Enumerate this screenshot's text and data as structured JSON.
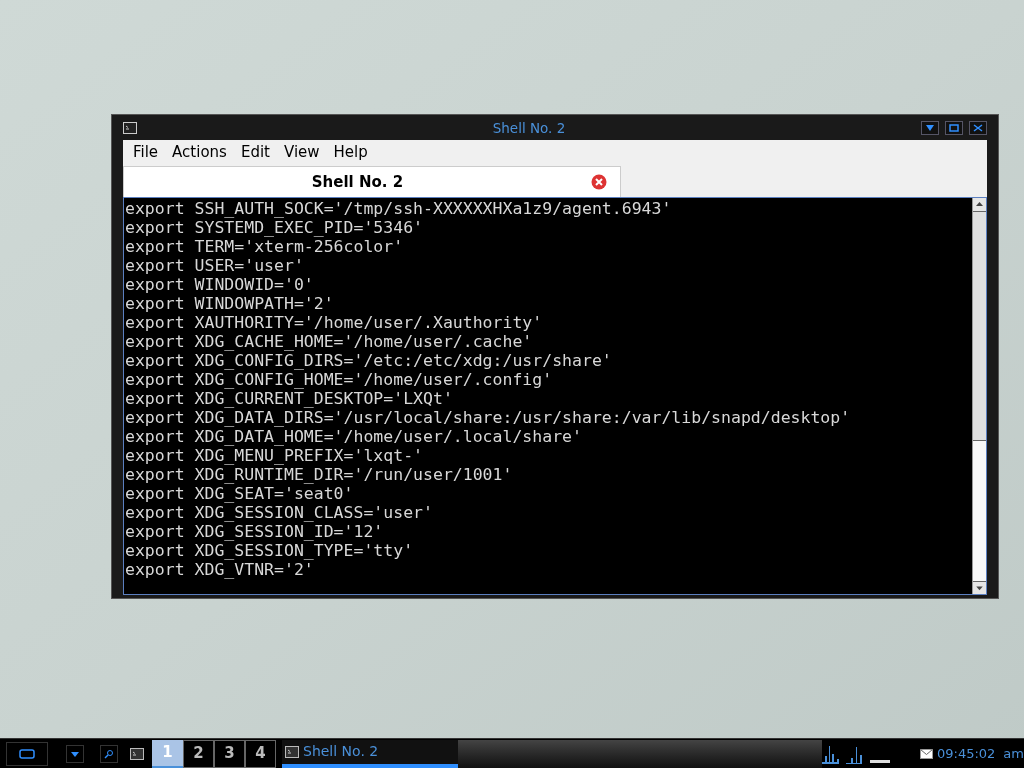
{
  "window": {
    "title": "Shell No. 2"
  },
  "menu": [
    "File",
    "Actions",
    "Edit",
    "View",
    "Help"
  ],
  "tabs": [
    {
      "label": "Shell No. 2",
      "selected": true
    }
  ],
  "terminal_lines": [
    "export SSH_AUTH_SOCK='/tmp/ssh-XXXXXXHXa1z9/agent.6943'",
    "export SYSTEMD_EXEC_PID='5346'",
    "export TERM='xterm-256color'",
    "export USER='user'",
    "export WINDOWID='0'",
    "export WINDOWPATH='2'",
    "export XAUTHORITY='/home/user/.Xauthority'",
    "export XDG_CACHE_HOME='/home/user/.cache'",
    "export XDG_CONFIG_DIRS='/etc:/etc/xdg:/usr/share'",
    "export XDG_CONFIG_HOME='/home/user/.config'",
    "export XDG_CURRENT_DESKTOP='LXQt'",
    "export XDG_DATA_DIRS='/usr/local/share:/usr/share:/var/lib/snapd/desktop'",
    "export XDG_DATA_HOME='/home/user/.local/share'",
    "export XDG_MENU_PREFIX='lxqt-'",
    "export XDG_RUNTIME_DIR='/run/user/1001'",
    "export XDG_SEAT='seat0'",
    "export XDG_SESSION_CLASS='user'",
    "export XDG_SESSION_ID='12'",
    "export XDG_SESSION_TYPE='tty'",
    "export XDG_VTNR='2'"
  ],
  "taskbar": {
    "desktops": [
      {
        "label": "1",
        "selected": true
      },
      {
        "label": "2",
        "selected": false
      },
      {
        "label": "3",
        "selected": false
      },
      {
        "label": "4",
        "selected": false
      }
    ],
    "tasks": [
      {
        "label": "Shell No. 2",
        "selected": true
      }
    ],
    "clock": "09:45:02",
    "clock_suffix": "am"
  }
}
